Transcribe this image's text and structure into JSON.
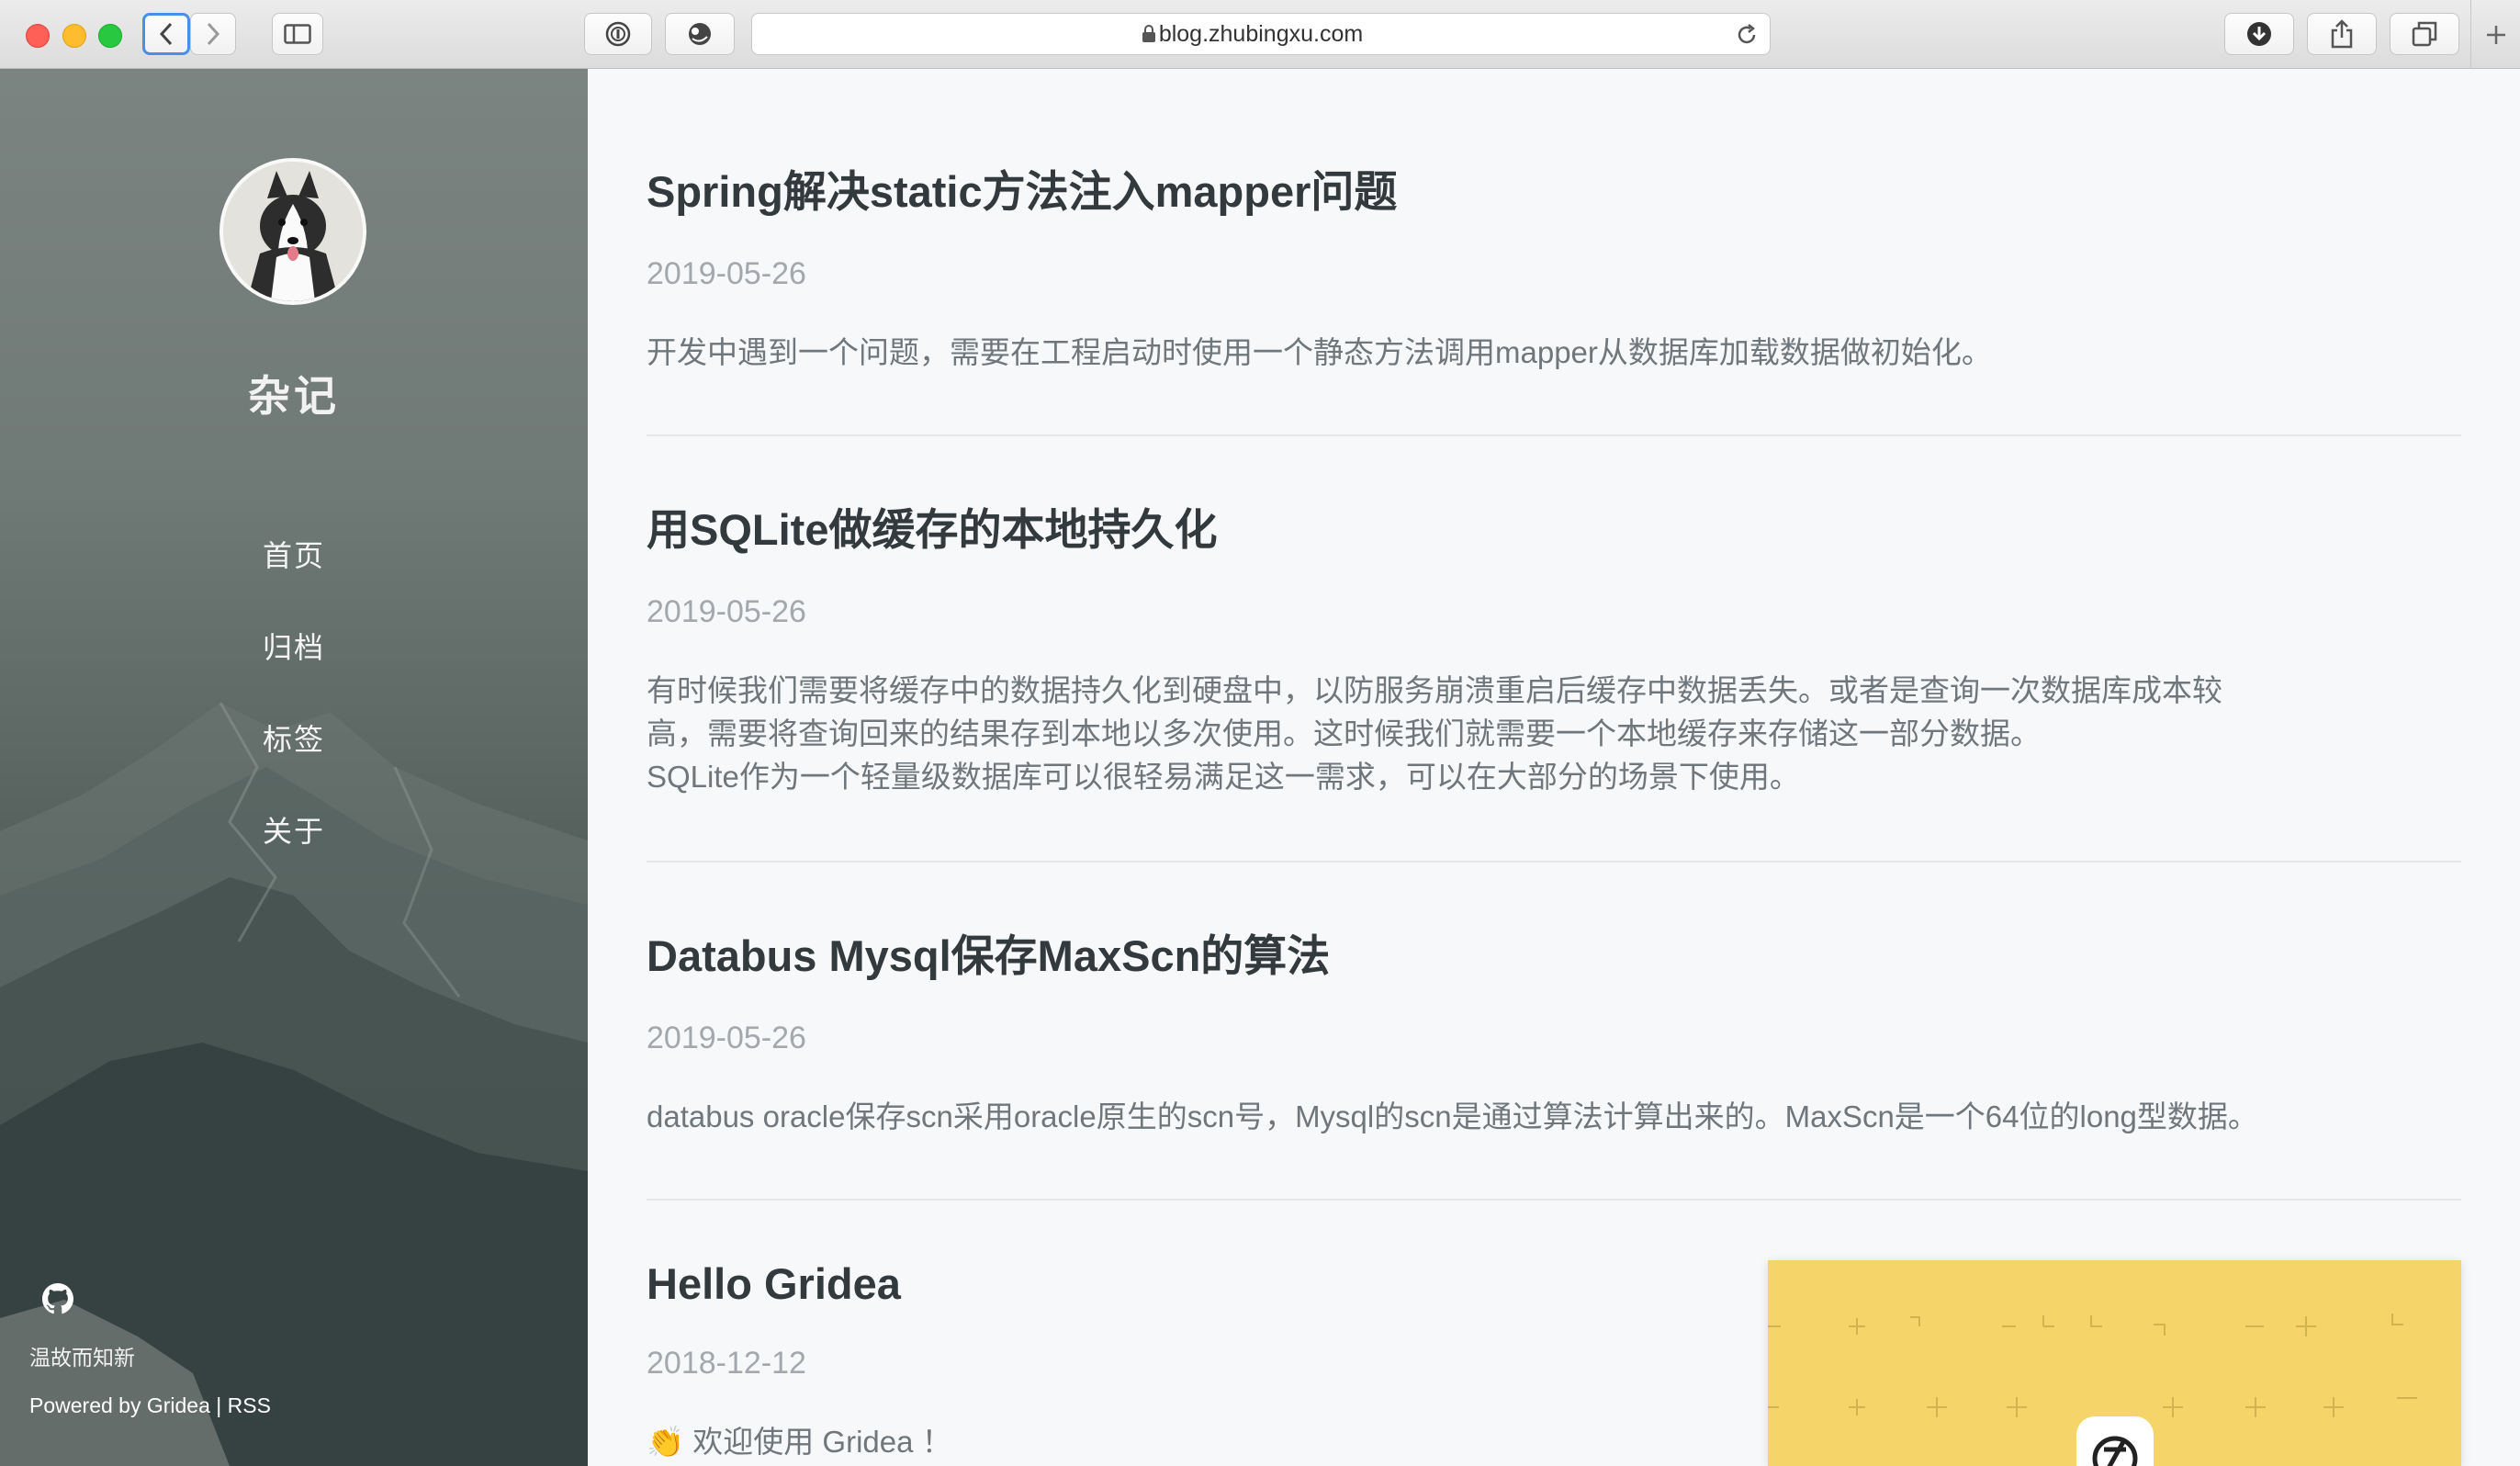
{
  "browser": {
    "url": "blog.zhubingxu.com",
    "icons": [
      "back-icon",
      "forward-icon",
      "sidebar-toggle-icon",
      "password-icon",
      "extension-icon",
      "lock-icon",
      "reload-icon",
      "download-icon",
      "share-icon",
      "tabs-overview-icon",
      "new-tab-icon"
    ]
  },
  "sidebar": {
    "title": "杂记",
    "nav": [
      {
        "label": "首页"
      },
      {
        "label": "归档"
      },
      {
        "label": "标签"
      },
      {
        "label": "关于"
      }
    ],
    "motto": "温故而知新",
    "powered_prefix": "Powered by ",
    "powered_gridea": "Gridea",
    "powered_sep": " | ",
    "powered_rss": "RSS"
  },
  "posts": [
    {
      "title": "Spring解决static方法注入mapper问题",
      "date": "2019-05-26",
      "abstract": "开发中遇到一个问题，需要在工程启动时使用一个静态方法调用mapper从数据库加载数据做初始化。"
    },
    {
      "title": "用SQLite做缓存的本地持久化",
      "date": "2019-05-26",
      "abstract_lines": [
        "有时候我们需要将缓存中的数据持久化到硬盘中，以防服务崩溃重启后缓存中数据丢失。或者是查询一次数据库成本较",
        "高，需要将查询回来的结果存到本地以多次使用。这时候我们就需要一个本地缓存来存储这一部分数据。",
        "SQLite作为一个轻量级数据库可以很轻易满足这一需求，可以在大部分的场景下使用。"
      ]
    },
    {
      "title": "Databus Mysql保存MaxScn的算法",
      "date": "2019-05-26",
      "abstract": "databus oracle保存scn采用oracle原生的scn号，Mysql的scn是通过算法计算出来的。MaxScn是一个64位的long型数据。"
    },
    {
      "title": "Hello Gridea",
      "date": "2018-12-12",
      "abstract": "👏 欢迎使用 Gridea ！"
    }
  ],
  "colors": {
    "widget_yellow": "#f5d469",
    "title_text": "#333a3e",
    "date_text": "#a2a8ad",
    "abstract_text": "#6f777c"
  }
}
